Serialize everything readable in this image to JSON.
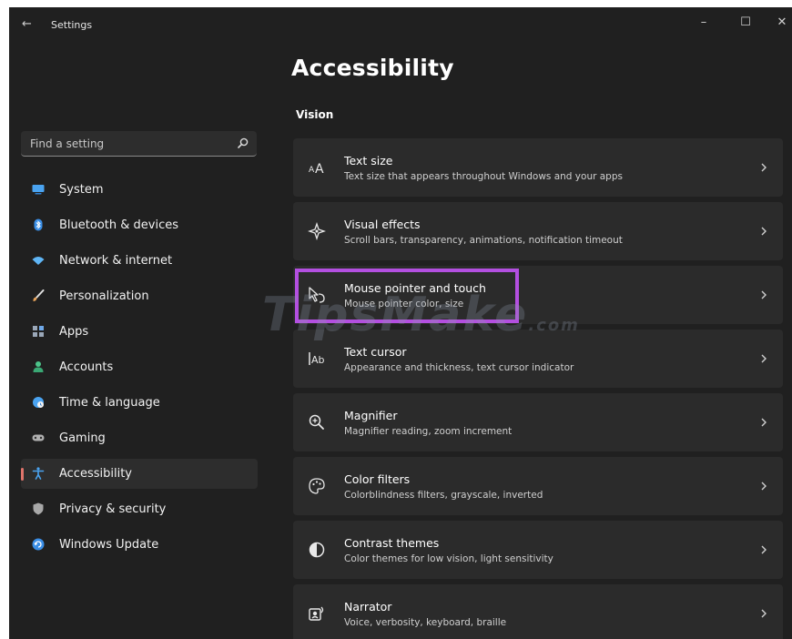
{
  "window": {
    "back_glyph": "←",
    "title": "Settings",
    "minimize_glyph": "–",
    "maximize_glyph": "☐",
    "close_glyph": "✕"
  },
  "search": {
    "placeholder": "Find a setting",
    "icon": "search-icon"
  },
  "sidebar": {
    "items": [
      {
        "label": "System",
        "icon": "monitor-icon",
        "color": "#4aa3f0"
      },
      {
        "label": "Bluetooth & devices",
        "icon": "bluetooth-icon",
        "color": "#3a8ee6"
      },
      {
        "label": "Network & internet",
        "icon": "wifi-icon",
        "color": "#5fb5f5"
      },
      {
        "label": "Personalization",
        "icon": "brush-icon",
        "color": "#e8a35a"
      },
      {
        "label": "Apps",
        "icon": "apps-icon",
        "color": "#9aa7b8"
      },
      {
        "label": "Accounts",
        "icon": "person-icon",
        "color": "#4cc48a"
      },
      {
        "label": "Time & language",
        "icon": "globe-clock-icon",
        "color": "#4aa3f0"
      },
      {
        "label": "Gaming",
        "icon": "gamepad-icon",
        "color": "#b0b0b0"
      },
      {
        "label": "Accessibility",
        "icon": "accessibility-icon",
        "color": "#4aa3f0",
        "active": true
      },
      {
        "label": "Privacy & security",
        "icon": "shield-icon",
        "color": "#a8a8a8"
      },
      {
        "label": "Windows Update",
        "icon": "update-icon",
        "color": "#3a8ee6"
      }
    ]
  },
  "main": {
    "title": "Accessibility",
    "section": "Vision",
    "cards": [
      {
        "title": "Text size",
        "desc": "Text size that appears throughout Windows and your apps",
        "icon": "text-size-icon"
      },
      {
        "title": "Visual effects",
        "desc": "Scroll bars, transparency, animations, notification timeout",
        "icon": "sparkle-icon"
      },
      {
        "title": "Mouse pointer and touch",
        "desc": "Mouse pointer color, size",
        "icon": "pointer-touch-icon"
      },
      {
        "title": "Text cursor",
        "desc": "Appearance and thickness, text cursor indicator",
        "icon": "text-cursor-icon"
      },
      {
        "title": "Magnifier",
        "desc": "Magnifier reading, zoom increment",
        "icon": "magnifier-icon"
      },
      {
        "title": "Color filters",
        "desc": "Colorblindness filters, grayscale, inverted",
        "icon": "palette-icon"
      },
      {
        "title": "Contrast themes",
        "desc": "Color themes for low vision, light sensitivity",
        "icon": "contrast-icon"
      },
      {
        "title": "Narrator",
        "desc": "Voice, verbosity, keyboard, braille",
        "icon": "narrator-icon"
      }
    ]
  },
  "watermark": {
    "main": "TipsMake",
    "suffix": ".com"
  },
  "colors": {
    "background": "#202020",
    "card": "#2b2b2b",
    "highlight": "#b34fe0",
    "indicator": "#e0746b"
  }
}
